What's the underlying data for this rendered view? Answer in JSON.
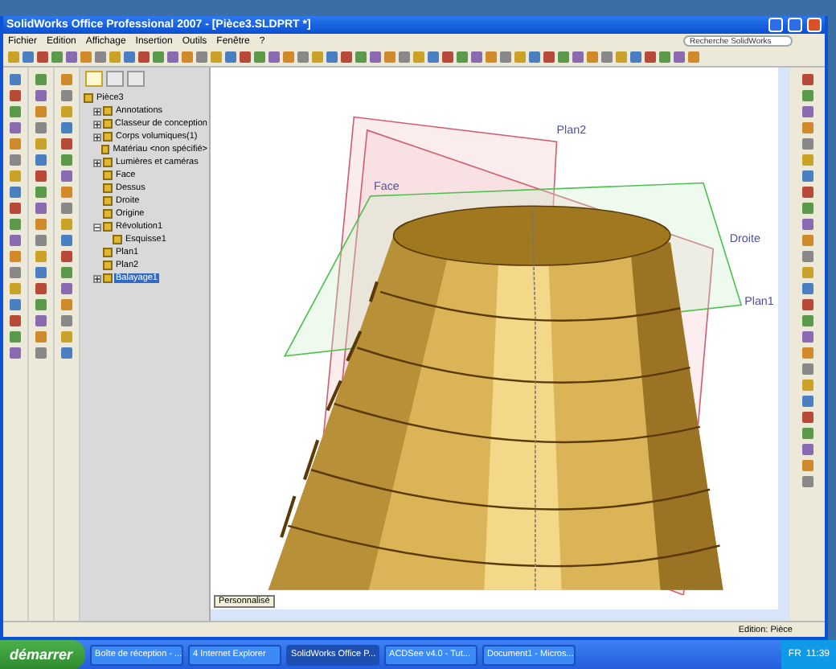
{
  "window": {
    "title": "SolidWorks Office Professional 2007 - [Pièce3.SLDPRT *]"
  },
  "menu": [
    "Fichier",
    "Edition",
    "Affichage",
    "Insertion",
    "Outils",
    "Fenêtre",
    "?"
  ],
  "search": {
    "placeholder": "Recherche SolidWorks"
  },
  "feature_tree": {
    "tabs": [
      {
        "selected": true
      },
      {
        "selected": false
      },
      {
        "selected": false
      }
    ],
    "root": {
      "label": "Pièce3",
      "children": [
        {
          "label": "Annotations",
          "expanded": false,
          "selected": false
        },
        {
          "label": "Classeur de conception",
          "expanded": false,
          "selected": false
        },
        {
          "label": "Corps volumiques(1)",
          "expanded": false,
          "selected": false
        },
        {
          "label": "Matériau <non spécifié>",
          "selected": false
        },
        {
          "label": "Lumières et caméras",
          "expanded": false,
          "selected": false
        },
        {
          "label": "Face",
          "selected": false
        },
        {
          "label": "Dessus",
          "selected": false
        },
        {
          "label": "Droite",
          "selected": false
        },
        {
          "label": "Origine",
          "selected": false
        },
        {
          "label": "Révolution1",
          "expanded": true,
          "selected": false,
          "children": [
            {
              "label": "Esquisse1",
              "selected": false
            }
          ]
        },
        {
          "label": "Plan1",
          "selected": false
        },
        {
          "label": "Plan2",
          "selected": false
        },
        {
          "label": "Balayage1",
          "expanded": false,
          "selected": true
        }
      ]
    }
  },
  "viewport": {
    "plane_labels": [
      "Plan2",
      "Face",
      "Droite",
      "Plan1"
    ],
    "view_tab": "Personnalisé"
  },
  "status_bar": {
    "text": "Edition: Pièce"
  },
  "taskbar": {
    "start": "démarrer",
    "tasks": [
      {
        "label": "Boîte de réception - ...",
        "selected": false
      },
      {
        "label": "4 Internet Explorer",
        "selected": false
      },
      {
        "label": "SolidWorks Office P...",
        "selected": true
      },
      {
        "label": "ACDSee v4.0 - Tut...",
        "selected": false
      },
      {
        "label": "Document1 - Micros...",
        "selected": false
      }
    ],
    "language": "FR",
    "clock": "11:39"
  }
}
